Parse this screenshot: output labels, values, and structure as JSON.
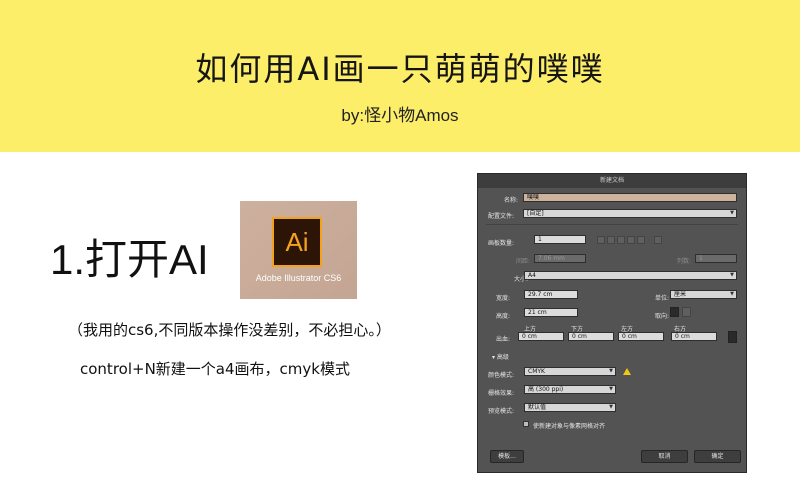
{
  "banner": {
    "title": "如何用AI画一只萌萌的噗噗",
    "subtitle": "by:怪小物Amos"
  },
  "step": {
    "title": "1.打开AI",
    "note": "（我用的cs6,不同版本操作没差别，不必担心。）",
    "instruction": "control+N新建一个a4画布，cmyk模式"
  },
  "ai_logo": {
    "letters": "Ai",
    "caption": "Adobe Illustrator CS6"
  },
  "dialog": {
    "title": "新建文档",
    "name_label": "名称:",
    "name_value": "噗噗",
    "profile_label": "配置文件:",
    "profile_value": "[自定]",
    "artboards_label": "画板数量:",
    "artboards_value": "1",
    "spacing_label": "间距:",
    "spacing_value": "7.06 mm",
    "columns_label": "列数:",
    "columns_value": "1",
    "size_label": "大小:",
    "size_value": "A4",
    "width_label": "宽度:",
    "width_value": "29.7 cm",
    "units_label": "单位:",
    "units_value": "厘米",
    "height_label": "高度:",
    "height_value": "21 cm",
    "orientation_label": "取向:",
    "bleed_label": "出血:",
    "bleed_top_label": "上方",
    "bleed_bottom_label": "下方",
    "bleed_left_label": "左方",
    "bleed_right_label": "右方",
    "bleed_value": "0 cm",
    "advanced_label": "高级",
    "color_mode_label": "颜色模式:",
    "color_mode_value": "CMYK",
    "raster_label": "栅格效果:",
    "raster_value": "高 (300 ppi)",
    "preview_label": "预览模式:",
    "preview_value": "默认值",
    "align_label": "使新建对象与像素网格对齐",
    "templates_button": "模板...",
    "cancel_button": "取消",
    "ok_button": "确定"
  }
}
